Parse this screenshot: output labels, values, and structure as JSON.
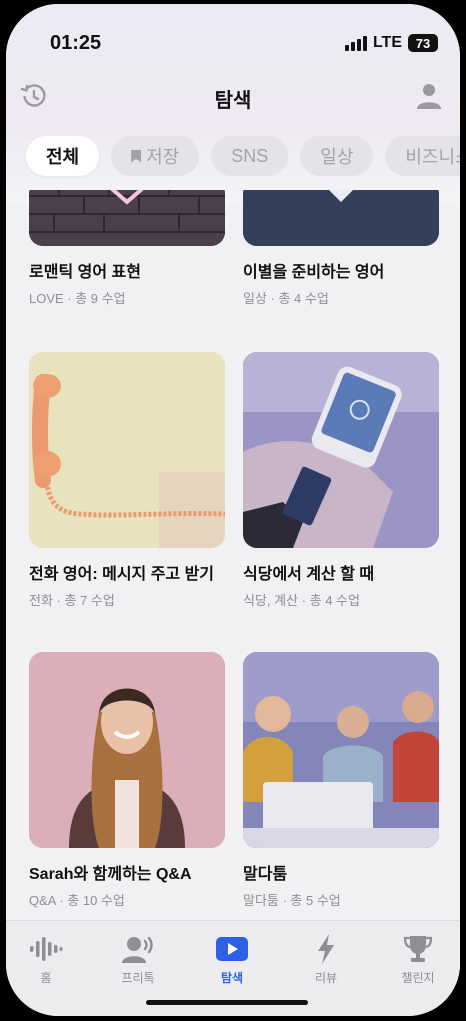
{
  "status": {
    "time": "01:25",
    "network": "LTE",
    "battery": "73"
  },
  "header": {
    "title": "탐색",
    "history_icon": "history-icon",
    "profile_icon": "profile-icon"
  },
  "chips": [
    {
      "label": "전체",
      "active": true
    },
    {
      "label": "저장",
      "icon": "bookmark-icon"
    },
    {
      "label": "SNS"
    },
    {
      "label": "일상"
    },
    {
      "label": "비즈니스"
    }
  ],
  "cards": [
    {
      "title": "로맨틱 영어 표현",
      "meta": "LOVE  ·  총 9 수업"
    },
    {
      "title": "이별을 준비하는 영어",
      "meta": "일상  ·  총 4 수업"
    },
    {
      "title": "전화 영어: 메시지 주고 받기",
      "meta": "전화  ·  총 7 수업"
    },
    {
      "title": "식당에서 계산 할 때",
      "meta": "식당, 계산  ·  총 4 수업"
    },
    {
      "title": "Sarah와 함께하는 Q&A",
      "meta": "Q&A  ·  총 10 수업"
    },
    {
      "title": "말다툼",
      "meta": "말다툼  ·  총 5 수업"
    }
  ],
  "tabbar": [
    {
      "label": "홈",
      "icon": "waveform-icon"
    },
    {
      "label": "프리톡",
      "icon": "speaking-person-icon"
    },
    {
      "label": "탐색",
      "icon": "play-icon",
      "active": true
    },
    {
      "label": "리뷰",
      "icon": "lightning-icon"
    },
    {
      "label": "챌린지",
      "icon": "trophy-icon"
    }
  ],
  "colors": {
    "accent": "#2d5fe8",
    "chip_bg": "#e4e3e8",
    "muted_text": "#8e8e93"
  }
}
